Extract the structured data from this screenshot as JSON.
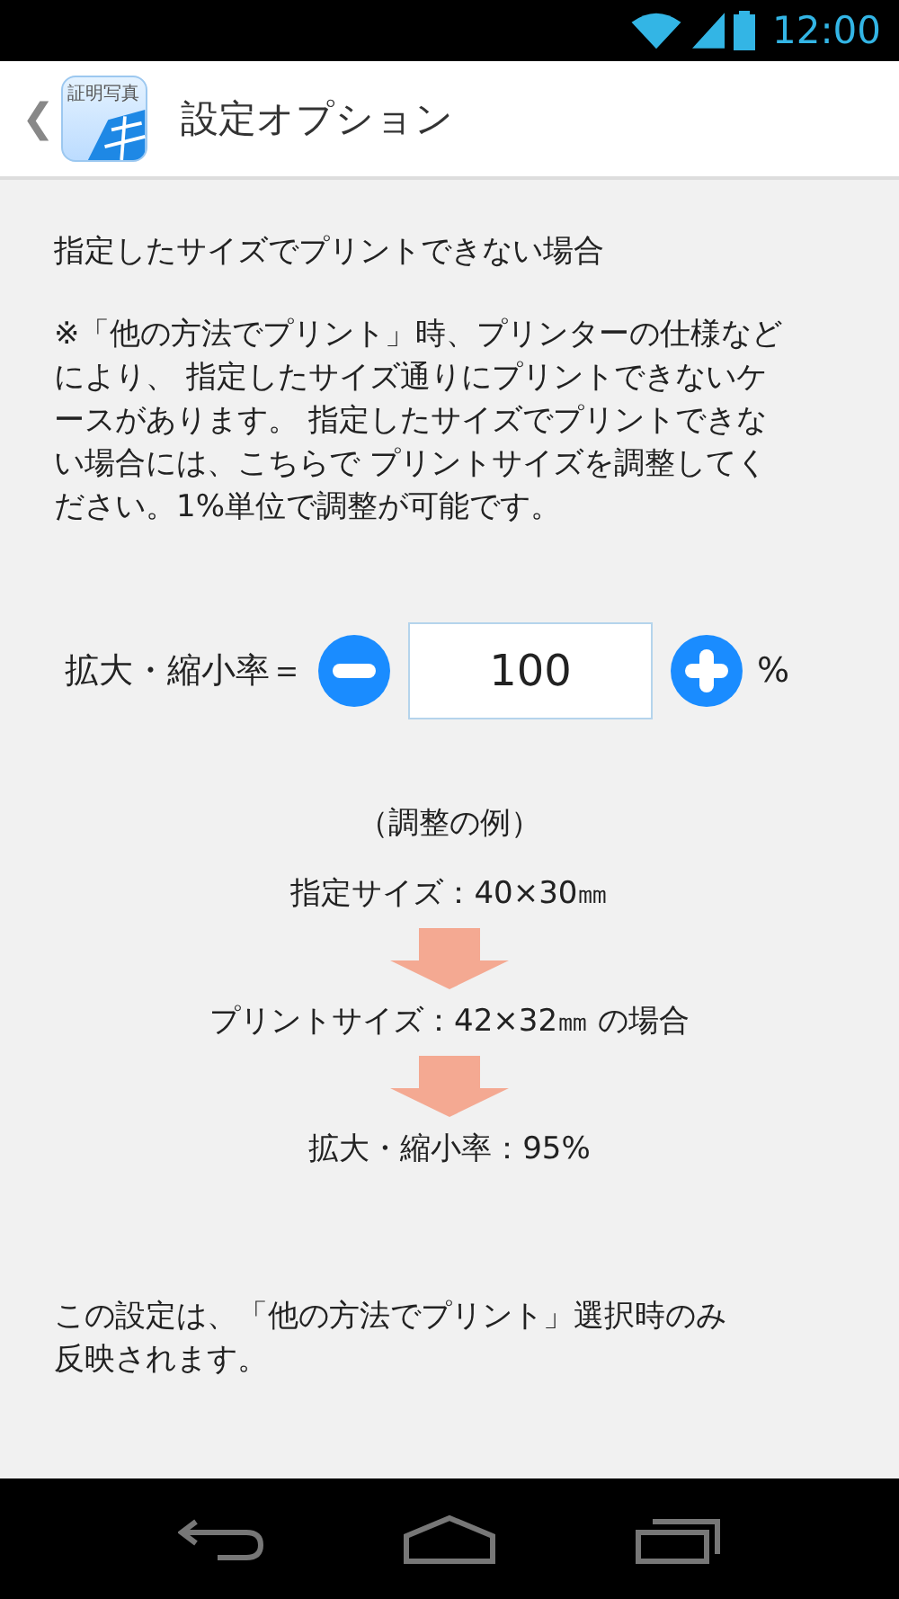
{
  "status_bar": {
    "time": "12:00"
  },
  "app_bar": {
    "back": "❮",
    "app_icon_label": "証明写真",
    "title": "設定オプション"
  },
  "heading": "指定したサイズでプリントできない場合",
  "note": "※「他の方法でプリント」時、プリンターの仕様などにより、 指定したサイズ通りにプリントできないケースがあります。 指定したサイズでプリントできない場合には、こちらで プリントサイズを調整してください。1%単位で調整が可能です。",
  "scale": {
    "label": "拡大・縮小率＝",
    "value": "100",
    "unit": "%"
  },
  "example": {
    "title": "（調整の例）",
    "steps": [
      "指定サイズ：40×30㎜",
      "プリントサイズ：42×32㎜ の場合",
      "拡大・縮小率：95%"
    ]
  },
  "footer_note": "この設定は、「他の方法でプリント」選択時のみ反映されます。"
}
